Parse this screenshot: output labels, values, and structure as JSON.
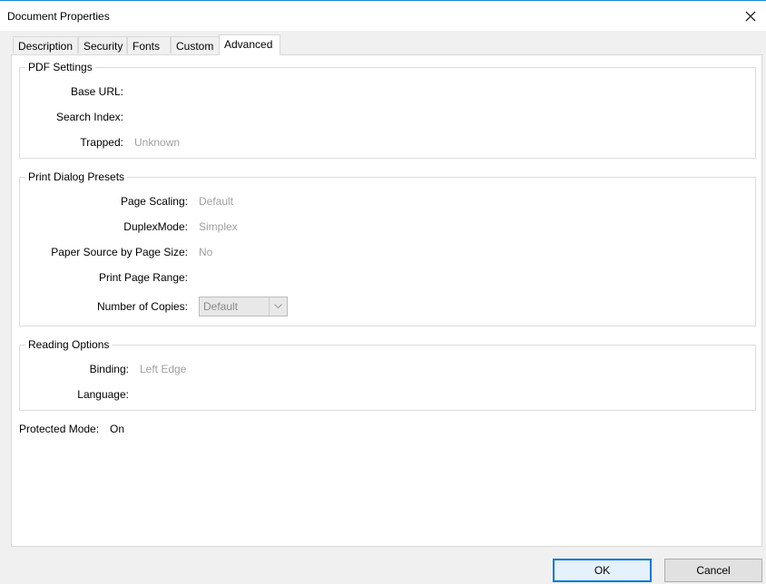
{
  "window": {
    "title": "Document Properties",
    "close_icon": "close-icon"
  },
  "tabs": [
    {
      "label": "Description",
      "active": false
    },
    {
      "label": "Security",
      "active": false
    },
    {
      "label": "Fonts",
      "active": false
    },
    {
      "label": "Custom",
      "active": false
    },
    {
      "label": "Advanced",
      "active": true
    }
  ],
  "pdf_settings": {
    "title": "PDF Settings",
    "base_url_label": "Base URL:",
    "base_url_value": "",
    "search_index_label": "Search Index:",
    "search_index_value": "",
    "trapped_label": "Trapped:",
    "trapped_value": "Unknown"
  },
  "print_presets": {
    "title": "Print Dialog Presets",
    "page_scaling_label": "Page Scaling:",
    "page_scaling_value": "Default",
    "duplex_label": "DuplexMode:",
    "duplex_value": "Simplex",
    "paper_source_label": "Paper Source by Page Size:",
    "paper_source_value": "No",
    "print_range_label": "Print Page Range:",
    "print_range_value": "",
    "copies_label": "Number of Copies:",
    "copies_value": "Default"
  },
  "reading_options": {
    "title": "Reading Options",
    "binding_label": "Binding:",
    "binding_value": "Left Edge",
    "language_label": "Language:",
    "language_value": ""
  },
  "protected_mode": {
    "label": "Protected Mode:",
    "value": "On"
  },
  "buttons": {
    "ok": "OK",
    "cancel": "Cancel"
  },
  "colors": {
    "accent": "#0078d7",
    "title_border": "#1883d7",
    "disabled_text": "#a0a0a0"
  }
}
